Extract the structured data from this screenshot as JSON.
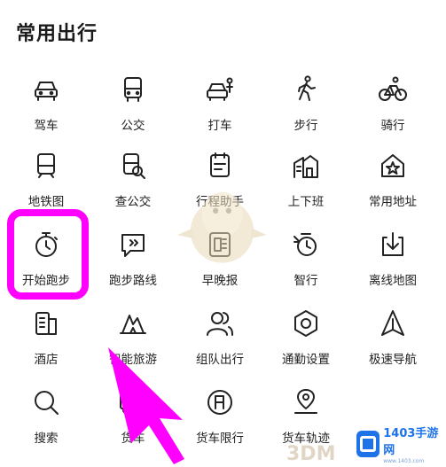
{
  "section_title": "常用出行",
  "items": [
    {
      "label": "驾车",
      "icon": "car-icon"
    },
    {
      "label": "公交",
      "icon": "bus-icon"
    },
    {
      "label": "打车",
      "icon": "taxi-icon"
    },
    {
      "label": "步行",
      "icon": "walking-icon"
    },
    {
      "label": "骑行",
      "icon": "cycling-icon"
    },
    {
      "label": "地铁图",
      "icon": "subway-icon"
    },
    {
      "label": "查公交",
      "icon": "bus-search-icon"
    },
    {
      "label": "行程助手",
      "icon": "trip-assistant-icon"
    },
    {
      "label": "上下班",
      "icon": "commute-icon"
    },
    {
      "label": "常用地址",
      "icon": "home-star-icon"
    },
    {
      "label": "开始跑步",
      "icon": "stopwatch-icon"
    },
    {
      "label": "跑步路线",
      "icon": "running-route-icon"
    },
    {
      "label": "早晚报",
      "icon": "report-icon"
    },
    {
      "label": "智行",
      "icon": "smart-travel-icon"
    },
    {
      "label": "离线地图",
      "icon": "offline-map-icon"
    },
    {
      "label": "酒店",
      "icon": "hotel-icon"
    },
    {
      "label": "智能旅游",
      "icon": "smart-tour-icon"
    },
    {
      "label": "组队出行",
      "icon": "team-icon"
    },
    {
      "label": "通勤设置",
      "icon": "settings-icon"
    },
    {
      "label": "极速导航",
      "icon": "navigation-icon"
    },
    {
      "label": "搜索",
      "icon": "search-icon"
    },
    {
      "label": "货车",
      "icon": "truck-icon"
    },
    {
      "label": "货车限行",
      "icon": "truck-restriction-icon"
    },
    {
      "label": "货车轨迹",
      "icon": "truck-track-icon"
    }
  ],
  "watermark": {
    "text_3dm": "3DM",
    "badge_main": "1403手游网",
    "badge_sub": "www.1403.com"
  },
  "colors": {
    "highlight": "#ff00ff",
    "icon_stroke": "#222222"
  }
}
